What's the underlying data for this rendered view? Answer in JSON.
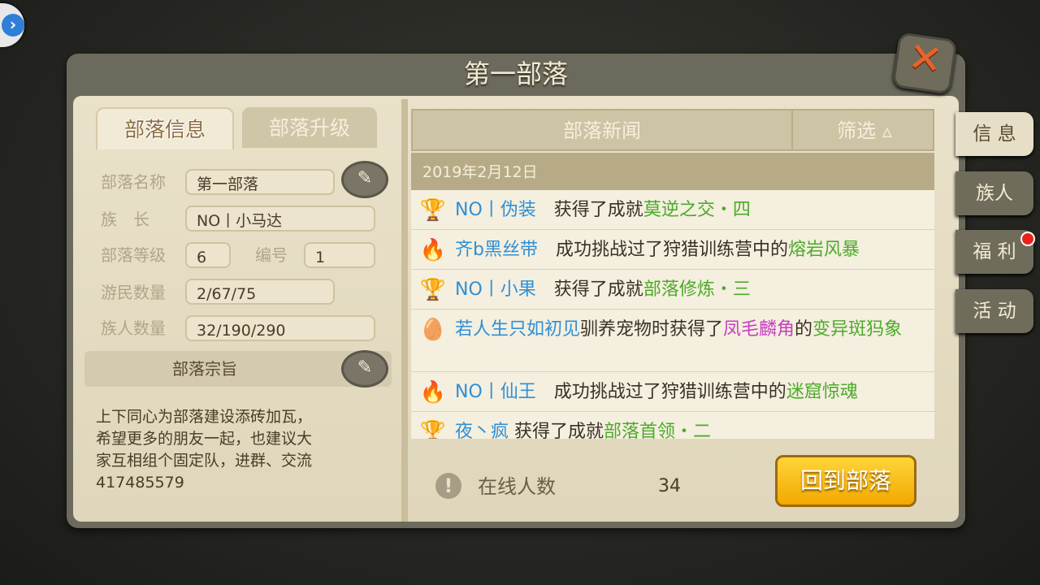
{
  "window": {
    "title": "第一部落",
    "close_icon": "close-icon"
  },
  "left": {
    "tabs": [
      {
        "label": "部落信息",
        "active": true
      },
      {
        "label": "部落升级",
        "active": false
      }
    ],
    "fields": {
      "name_label": "部落名称",
      "name_value": "第一部落",
      "leader_label": "族　长",
      "leader_value": "NO丨小马达",
      "level_label": "部落等级",
      "level_value": "6",
      "id_label": "编号",
      "id_value": "1",
      "nomads_label": "游民数量",
      "nomads_value": "2/67/75",
      "members_label": "族人数量",
      "members_value": "32/190/290"
    },
    "motto_title": "部落宗旨",
    "motto_lines": [
      "上下同心为部落建设添砖加瓦，",
      "希望更多的朋友一起，也建议大",
      "家互相组个固定队，进群、交流",
      "417485579"
    ]
  },
  "news": {
    "header_title": "部落新闻",
    "filter_label": "筛选 ▵",
    "date": "2019年2月12日",
    "rows": [
      {
        "icon": "trophy-icon",
        "glyph": "🏆",
        "p1": "NO丨伪装",
        "p2": "获得了成就",
        "p3": "莫逆之交・四"
      },
      {
        "icon": "torch-icon",
        "glyph": "🔥",
        "p1": "齐b黑丝带",
        "p2": "成功挑战过了狩猎训练营中的",
        "p3": "熔岩风暴"
      },
      {
        "icon": "trophy-icon",
        "glyph": "🏆",
        "p1": "NO丨小果",
        "p2": "获得了成就",
        "p3": "部落修炼・三"
      },
      {
        "icon": "pet-egg-icon",
        "glyph": "🥚",
        "p1": "若人生只如初见",
        "p2": "驯养宠物时获得了",
        "p3": "凤毛麟角",
        "p4": "的",
        "p5": "变异斑犸象"
      },
      {
        "icon": "torch-icon",
        "glyph": "🔥",
        "p1": "NO丨仙王",
        "p2": "成功挑战过了狩猎训练营中的",
        "p3": "迷窟惊魂"
      },
      {
        "icon": "trophy-icon",
        "glyph": "🏆",
        "p1": "夜丶疯",
        "p2": "获得了成就",
        "p3": "部落首领・二"
      }
    ]
  },
  "footer": {
    "online_label": "在线人数",
    "online_count": "34",
    "return_label": "回到部落"
  },
  "side_tabs": [
    {
      "label": "信 息"
    },
    {
      "label": "族人"
    },
    {
      "label": "福 利"
    },
    {
      "label": "活 动"
    }
  ],
  "float_button": "›"
}
